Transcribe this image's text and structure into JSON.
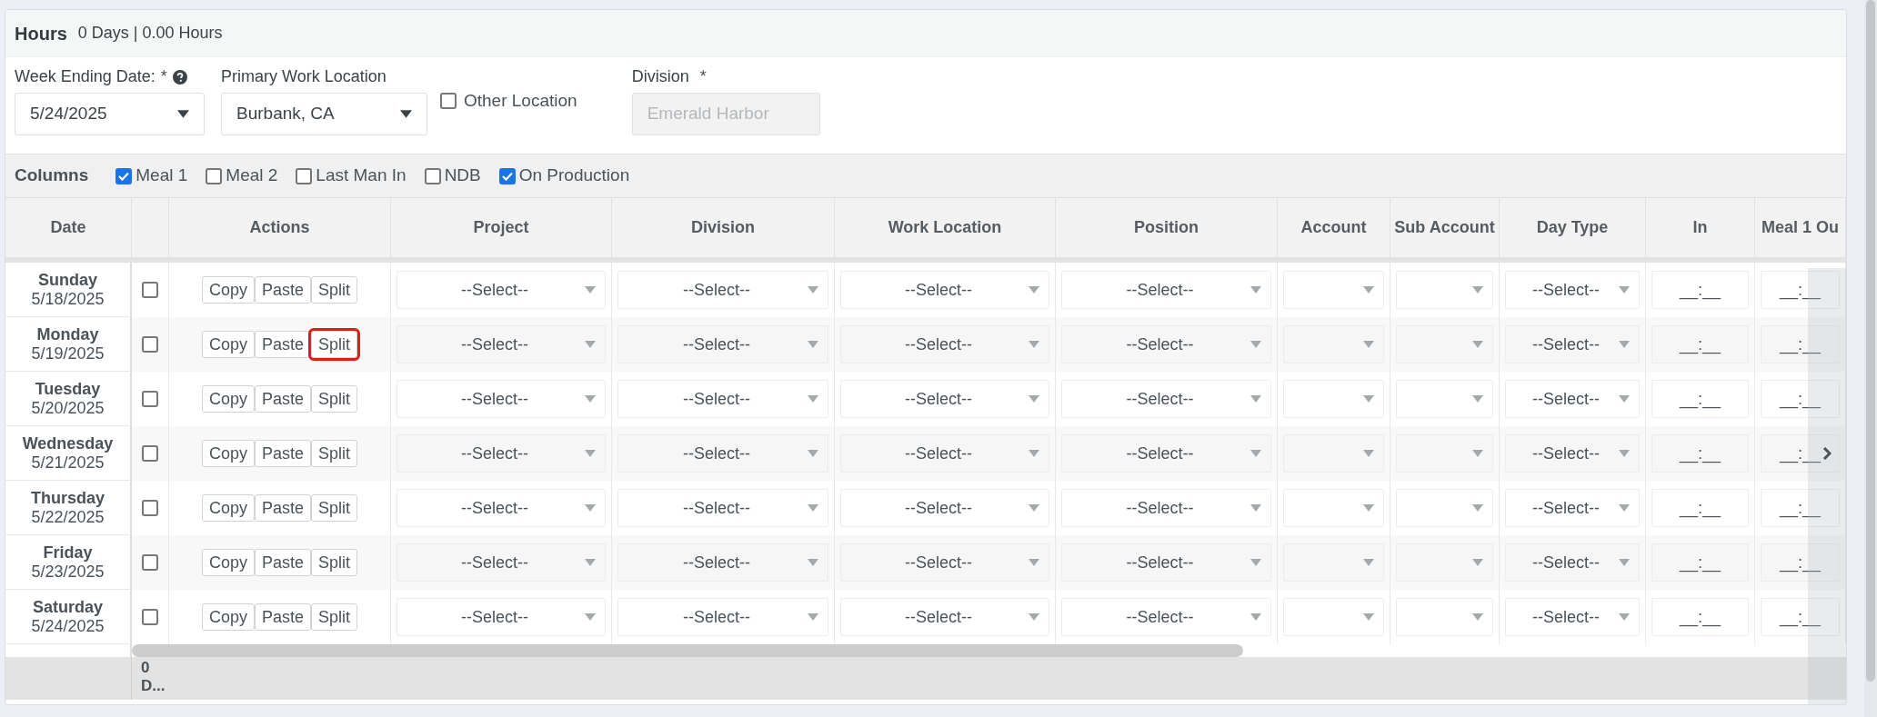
{
  "header": {
    "title": "Hours",
    "summary": "0 Days | 0.00 Hours"
  },
  "fields": [
    {
      "kind": "select",
      "label": "Week Ending Date:",
      "required_mark": "*",
      "help": true,
      "value": "5/24/2025"
    },
    {
      "kind": "select",
      "label": "Primary Work Location",
      "value": "Burbank, CA"
    },
    {
      "kind": "checkbox",
      "label": "Other Location",
      "checked": false
    },
    {
      "kind": "text",
      "label": "Division",
      "required_mark": "*",
      "value": "Emerald Harbor",
      "disabled": true
    }
  ],
  "columns_bar": {
    "label": "Columns",
    "options": [
      {
        "label": "Meal 1",
        "checked": true
      },
      {
        "label": "Meal 2",
        "checked": false
      },
      {
        "label": "Last Man In",
        "checked": false
      },
      {
        "label": "NDB",
        "checked": false
      },
      {
        "label": "On Production",
        "checked": true
      }
    ]
  },
  "table": {
    "fixed_columns": [
      "Date",
      "Actions"
    ],
    "columns": [
      "Project",
      "Division",
      "Work Location",
      "Position",
      "Account",
      "Sub Account",
      "Day Type",
      "In",
      "Meal 1 Ou"
    ],
    "rows": [
      {
        "day": "Sunday",
        "date": "5/18/2025",
        "checked": false,
        "actions": [
          {
            "label": "Copy",
            "highlighted": false
          },
          {
            "label": "Paste",
            "highlighted": false
          },
          {
            "label": "Split",
            "highlighted": false
          }
        ],
        "cells": [
          {
            "kind": "select",
            "value": "--Select--"
          },
          {
            "kind": "select",
            "value": "--Select--"
          },
          {
            "kind": "select",
            "value": "--Select--"
          },
          {
            "kind": "select",
            "value": "--Select--"
          },
          {
            "kind": "select"
          },
          {
            "kind": "select"
          },
          {
            "kind": "select",
            "value": "--Select--"
          },
          {
            "kind": "time",
            "value": "__:__"
          },
          {
            "kind": "time",
            "value": "__:__"
          }
        ]
      },
      {
        "day": "Monday",
        "date": "5/19/2025",
        "checked": false,
        "actions": [
          {
            "label": "Copy",
            "highlighted": false
          },
          {
            "label": "Paste",
            "highlighted": false
          },
          {
            "label": "Split",
            "highlighted": true
          }
        ],
        "cells": [
          {
            "kind": "select",
            "value": "--Select--"
          },
          {
            "kind": "select",
            "value": "--Select--"
          },
          {
            "kind": "select",
            "value": "--Select--"
          },
          {
            "kind": "select",
            "value": "--Select--"
          },
          {
            "kind": "select"
          },
          {
            "kind": "select"
          },
          {
            "kind": "select",
            "value": "--Select--"
          },
          {
            "kind": "time",
            "value": "__:__"
          },
          {
            "kind": "time",
            "value": "__:__"
          }
        ]
      },
      {
        "day": "Tuesday",
        "date": "5/20/2025",
        "checked": false,
        "actions": [
          {
            "label": "Copy",
            "highlighted": false
          },
          {
            "label": "Paste",
            "highlighted": false
          },
          {
            "label": "Split",
            "highlighted": false
          }
        ],
        "cells": [
          {
            "kind": "select",
            "value": "--Select--"
          },
          {
            "kind": "select",
            "value": "--Select--"
          },
          {
            "kind": "select",
            "value": "--Select--"
          },
          {
            "kind": "select",
            "value": "--Select--"
          },
          {
            "kind": "select"
          },
          {
            "kind": "select"
          },
          {
            "kind": "select",
            "value": "--Select--"
          },
          {
            "kind": "time",
            "value": "__:__"
          },
          {
            "kind": "time",
            "value": "__:__"
          }
        ]
      },
      {
        "day": "Wednesday",
        "date": "5/21/2025",
        "checked": false,
        "actions": [
          {
            "label": "Copy",
            "highlighted": false
          },
          {
            "label": "Paste",
            "highlighted": false
          },
          {
            "label": "Split",
            "highlighted": false
          }
        ],
        "cells": [
          {
            "kind": "select",
            "value": "--Select--"
          },
          {
            "kind": "select",
            "value": "--Select--"
          },
          {
            "kind": "select",
            "value": "--Select--"
          },
          {
            "kind": "select",
            "value": "--Select--"
          },
          {
            "kind": "select"
          },
          {
            "kind": "select"
          },
          {
            "kind": "select",
            "value": "--Select--"
          },
          {
            "kind": "time",
            "value": "__:__"
          },
          {
            "kind": "time",
            "value": "__:__"
          }
        ]
      },
      {
        "day": "Thursday",
        "date": "5/22/2025",
        "checked": false,
        "actions": [
          {
            "label": "Copy",
            "highlighted": false
          },
          {
            "label": "Paste",
            "highlighted": false
          },
          {
            "label": "Split",
            "highlighted": false
          }
        ],
        "cells": [
          {
            "kind": "select",
            "value": "--Select--"
          },
          {
            "kind": "select",
            "value": "--Select--"
          },
          {
            "kind": "select",
            "value": "--Select--"
          },
          {
            "kind": "select",
            "value": "--Select--"
          },
          {
            "kind": "select"
          },
          {
            "kind": "select"
          },
          {
            "kind": "select",
            "value": "--Select--"
          },
          {
            "kind": "time",
            "value": "__:__"
          },
          {
            "kind": "time",
            "value": "__:__"
          }
        ]
      },
      {
        "day": "Friday",
        "date": "5/23/2025",
        "checked": false,
        "actions": [
          {
            "label": "Copy",
            "highlighted": false
          },
          {
            "label": "Paste",
            "highlighted": false
          },
          {
            "label": "Split",
            "highlighted": false
          }
        ],
        "cells": [
          {
            "kind": "select",
            "value": "--Select--"
          },
          {
            "kind": "select",
            "value": "--Select--"
          },
          {
            "kind": "select",
            "value": "--Select--"
          },
          {
            "kind": "select",
            "value": "--Select--"
          },
          {
            "kind": "select"
          },
          {
            "kind": "select"
          },
          {
            "kind": "select",
            "value": "--Select--"
          },
          {
            "kind": "time",
            "value": "__:__"
          },
          {
            "kind": "time",
            "value": "__:__"
          }
        ]
      },
      {
        "day": "Saturday",
        "date": "5/24/2025",
        "checked": false,
        "actions": [
          {
            "label": "Copy",
            "highlighted": false
          },
          {
            "label": "Paste",
            "highlighted": false
          },
          {
            "label": "Split",
            "highlighted": false
          }
        ],
        "cells": [
          {
            "kind": "select",
            "value": "--Select--"
          },
          {
            "kind": "select",
            "value": "--Select--"
          },
          {
            "kind": "select",
            "value": "--Select--"
          },
          {
            "kind": "select",
            "value": "--Select--"
          },
          {
            "kind": "select"
          },
          {
            "kind": "select"
          },
          {
            "kind": "select",
            "value": "--Select--"
          },
          {
            "kind": "time",
            "value": "__:__"
          },
          {
            "kind": "time",
            "value": "__:__"
          }
        ]
      }
    ],
    "footer_total": "0 D..."
  }
}
